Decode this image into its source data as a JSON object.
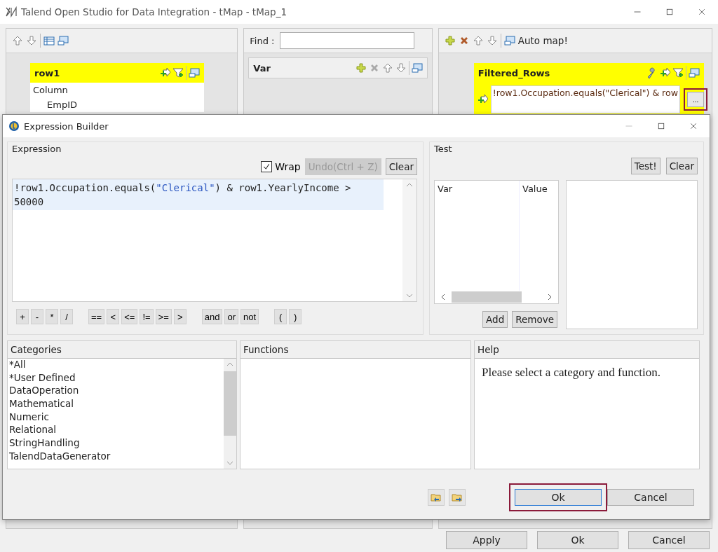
{
  "window": {
    "title": "Talend Open Studio for Data Integration - tMap - tMap_1"
  },
  "input_panel": {
    "table": {
      "title": "row1",
      "rows": [
        "Column",
        "EmpID"
      ]
    }
  },
  "var_panel": {
    "find_label": "Find :",
    "var_title": "Var"
  },
  "output_panel": {
    "auto_map": "Auto map!",
    "table": {
      "title": "Filtered_Rows",
      "expression": "!row1.Occupation.equals(\"Clerical\") & row",
      "more_button": "..."
    }
  },
  "dialog": {
    "title": "Expression Builder",
    "expression": {
      "label": "Expression",
      "wrap": {
        "label": "Wrap",
        "checked": true
      },
      "undo": {
        "label": "Undo(Ctrl + Z)",
        "disabled": true
      },
      "clear": "Clear",
      "code": [
        {
          "kind": "plain",
          "text": "!row1.Occupation.equals("
        },
        {
          "kind": "string",
          "text": "\"Clerical\""
        },
        {
          "kind": "plain",
          "text": ") & row1.YearlyIncome > 50000"
        }
      ],
      "operator_groups": [
        [
          "+",
          "-",
          "*",
          "/"
        ],
        [
          "==",
          "<",
          "<=",
          "!=",
          ">=",
          ">"
        ],
        [
          "and",
          "or",
          "not"
        ],
        [
          "(",
          ")"
        ]
      ]
    },
    "test": {
      "label": "Test",
      "test_button": "Test!",
      "clear": "Clear",
      "columns": [
        "Var",
        "Value"
      ],
      "add": "Add",
      "remove": "Remove"
    },
    "categories": {
      "header": "Categories",
      "items": [
        "*All",
        "*User Defined",
        "DataOperation",
        "Mathematical",
        "Numeric",
        "Relational",
        "StringHandling",
        "TalendDataGenerator"
      ]
    },
    "functions": {
      "header": "Functions"
    },
    "help": {
      "header": "Help",
      "text": "Please select a category and function."
    },
    "buttons": [
      {
        "label": "Ok",
        "focused": true
      },
      {
        "label": "Cancel",
        "focused": false
      }
    ]
  },
  "footer": {
    "buttons": [
      "Apply",
      "Ok",
      "Cancel"
    ]
  }
}
